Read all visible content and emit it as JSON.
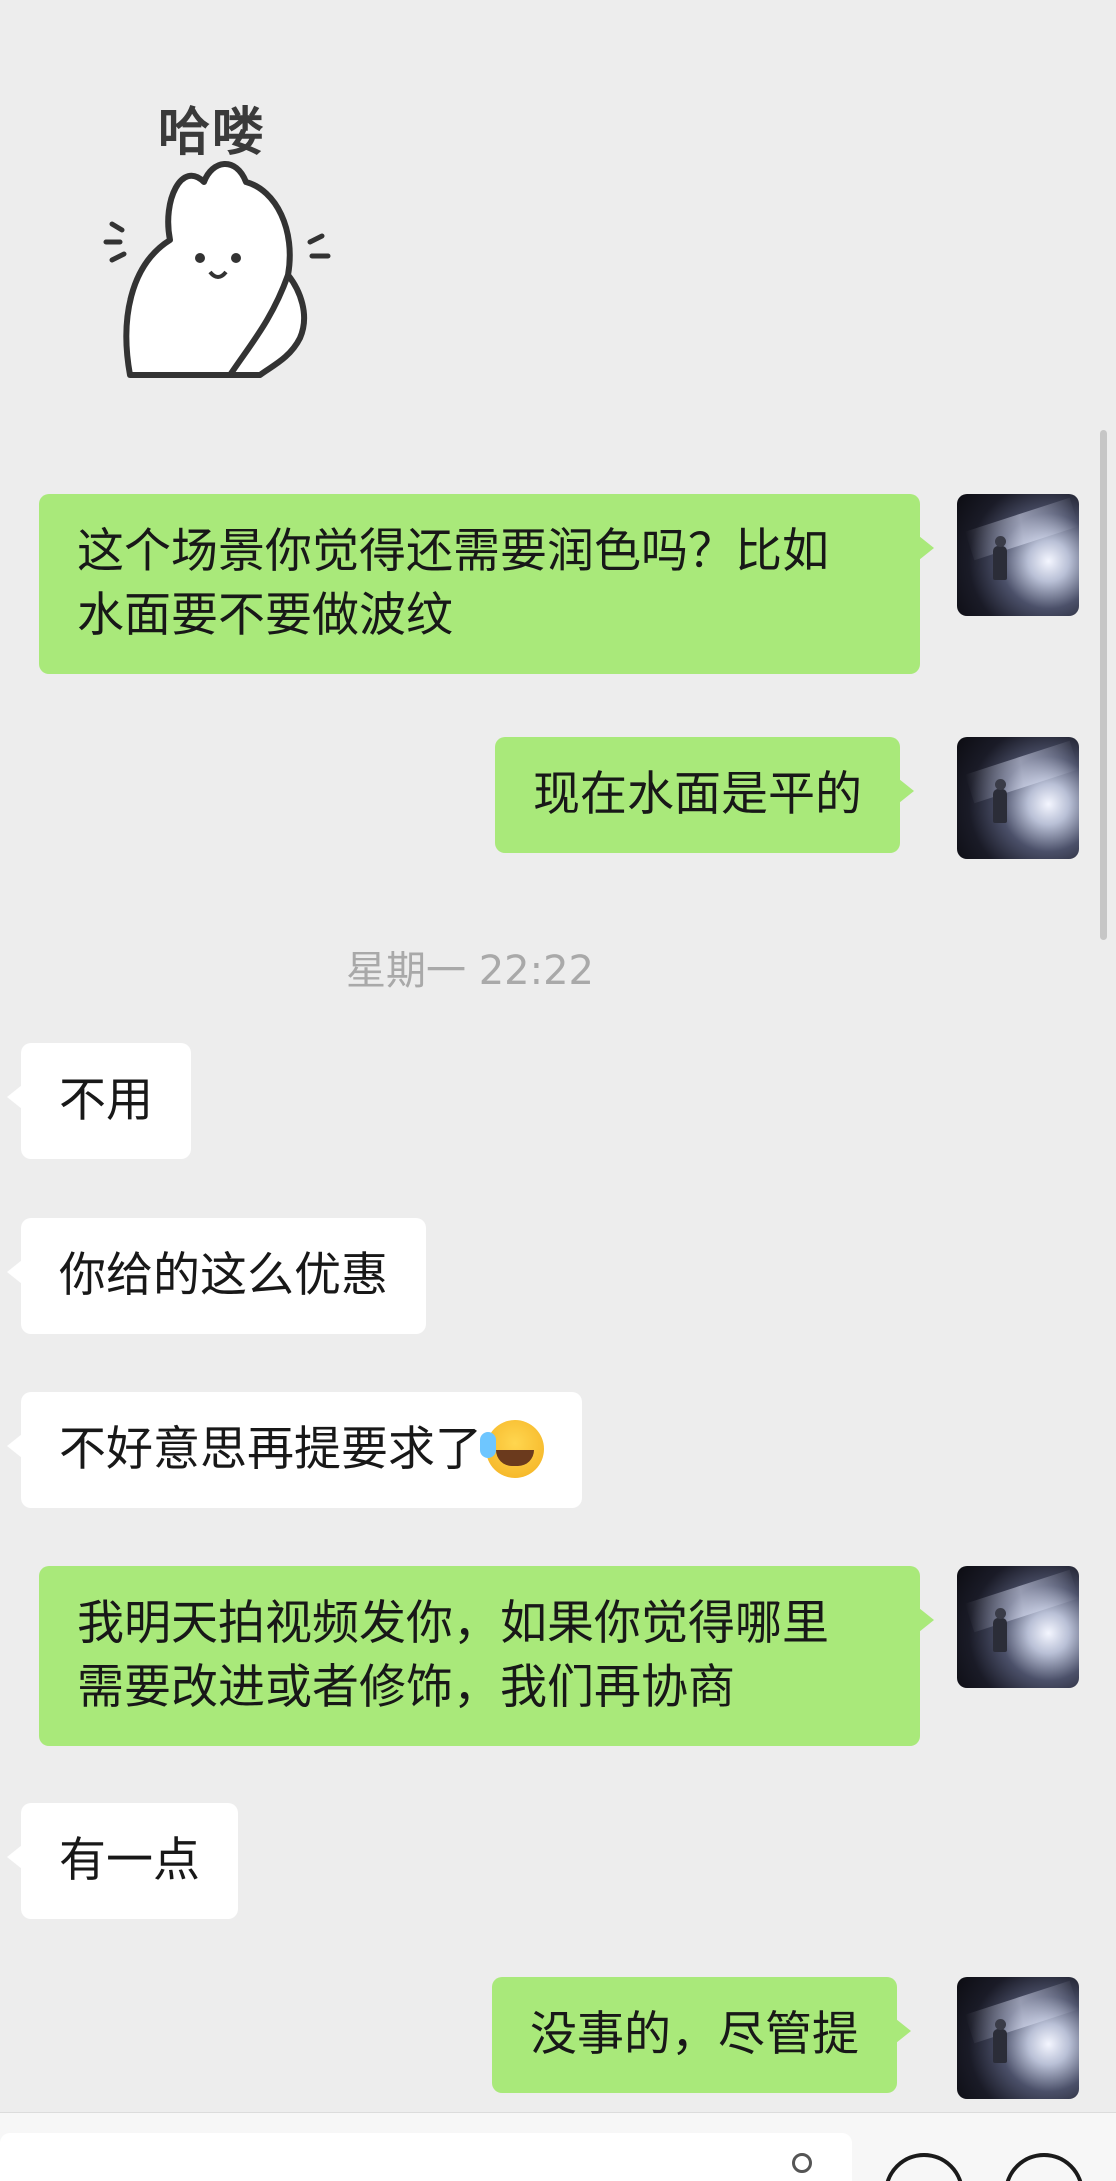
{
  "sticker": {
    "text": "哈喽",
    "icon": "waving-bunny-sticker"
  },
  "timestamp": "星期一 22:22",
  "messages": [
    {
      "direction": "out",
      "text": "这个场景你觉得还需要润色吗？比如\n水面要不要做波纹"
    },
    {
      "direction": "out",
      "text": "现在水面是平的"
    },
    {
      "direction": "in",
      "text": "不用"
    },
    {
      "direction": "in",
      "text": "你给的这么优惠"
    },
    {
      "direction": "in",
      "text": "不好意思再提要求了",
      "emoji": "facepalm-crying-laugh-emoji"
    },
    {
      "direction": "out",
      "text": "我明天拍视频发你，如果你觉得哪里\n需要改进或者修饰，我们再协商"
    },
    {
      "direction": "in",
      "text": "有一点"
    },
    {
      "direction": "out",
      "text": "没事的，尽管提"
    }
  ],
  "colors": {
    "background": "#ededed",
    "outgoing_bubble": "#a9e97a",
    "incoming_bubble": "#ffffff",
    "timestamp_text": "#a9a9a9"
  },
  "icons": {
    "avatar": "astronaut-avatar",
    "emoji_button": "emoji-face-icon",
    "more_button": "plus-circle-icon",
    "voice": "voice-icon"
  }
}
